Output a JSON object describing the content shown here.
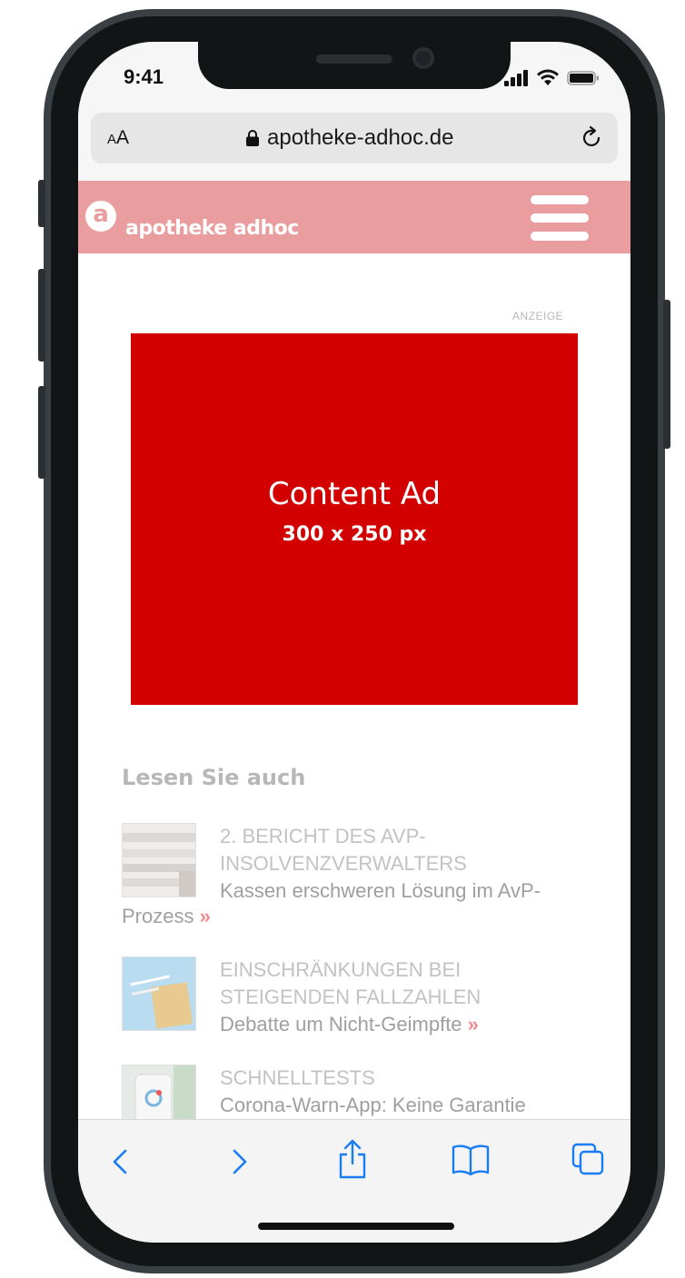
{
  "status_bar": {
    "time": "9:41"
  },
  "browser": {
    "text_size_small": "A",
    "text_size_large": "A",
    "url": "apotheke-adhoc.de"
  },
  "site": {
    "logo_letter": "a",
    "logo_text": "apotheke adhoc",
    "brand_color": "#ea9d9e"
  },
  "ad": {
    "label": "ANZEIGE",
    "title": "Content Ad",
    "size": "300 x 250 px",
    "color": "#d30000"
  },
  "related": {
    "heading": "Lesen Sie auch",
    "items": [
      {
        "kicker_line1": "2. BERICHT DES AVP-",
        "kicker_line2": "INSOLVENZVERWALTERS",
        "title_line1": "Kassen erschweren Lösung im AvP-",
        "title_line2": "Prozess",
        "more": "»"
      },
      {
        "kicker_line1": "EINSCHRÄNKUNGEN BEI",
        "kicker_line2": "STEIGENDEN FALLZAHLEN",
        "title_line1": "Debatte um Nicht-Geimpfte",
        "more": "»"
      },
      {
        "kicker_line1": "SCHNELLTESTS",
        "title_line1": "Corona-Warn-App: Keine Garantie"
      }
    ]
  },
  "toolbar": {
    "icons": [
      "back-icon",
      "forward-icon",
      "share-icon",
      "bookmarks-icon",
      "tabs-icon"
    ],
    "accent": "#1a7cf5"
  }
}
